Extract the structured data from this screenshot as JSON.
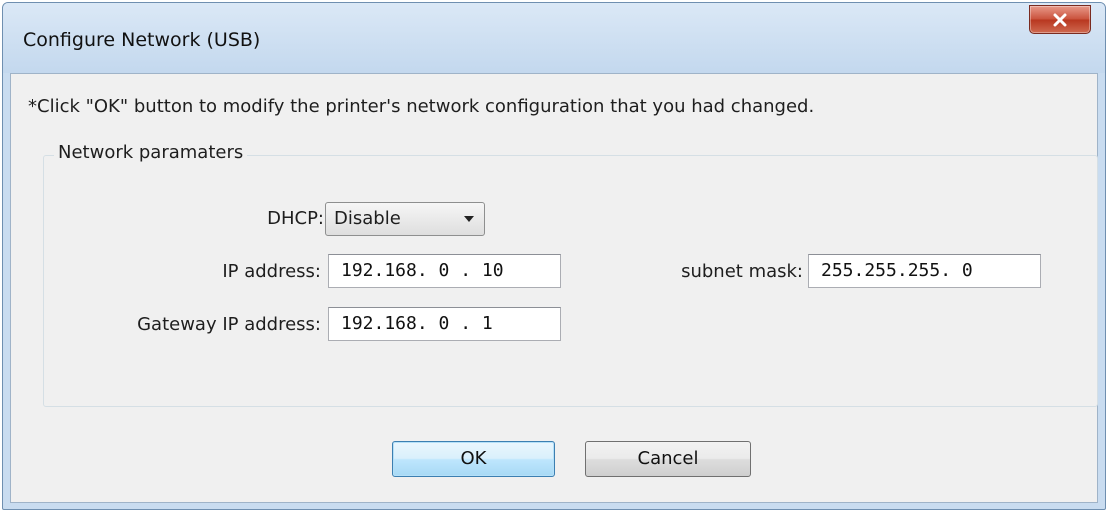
{
  "window": {
    "title": "Configure Network (USB)"
  },
  "instruction": "*Click \"OK\" button to modify the printer's network configuration that you had changed.",
  "group": {
    "title": "Network paramaters"
  },
  "dhcp": {
    "label": "DHCP:",
    "value": "Disable"
  },
  "ip_address": {
    "label": "IP address:",
    "value": "192.168. 0 . 10"
  },
  "subnet_mask": {
    "label": "subnet mask:",
    "value": "255.255.255. 0"
  },
  "gateway": {
    "label": "Gateway IP address:",
    "value": "192.168. 0 . 1"
  },
  "buttons": {
    "ok_label": "OK",
    "cancel_label": "Cancel"
  },
  "icons": {
    "close": "close-icon",
    "dropdown": "chevron-down-icon"
  },
  "colors": {
    "close_button": "#c9503a",
    "ok_button_border": "#3c7fb1",
    "window_frame": "#c9dcf0"
  }
}
